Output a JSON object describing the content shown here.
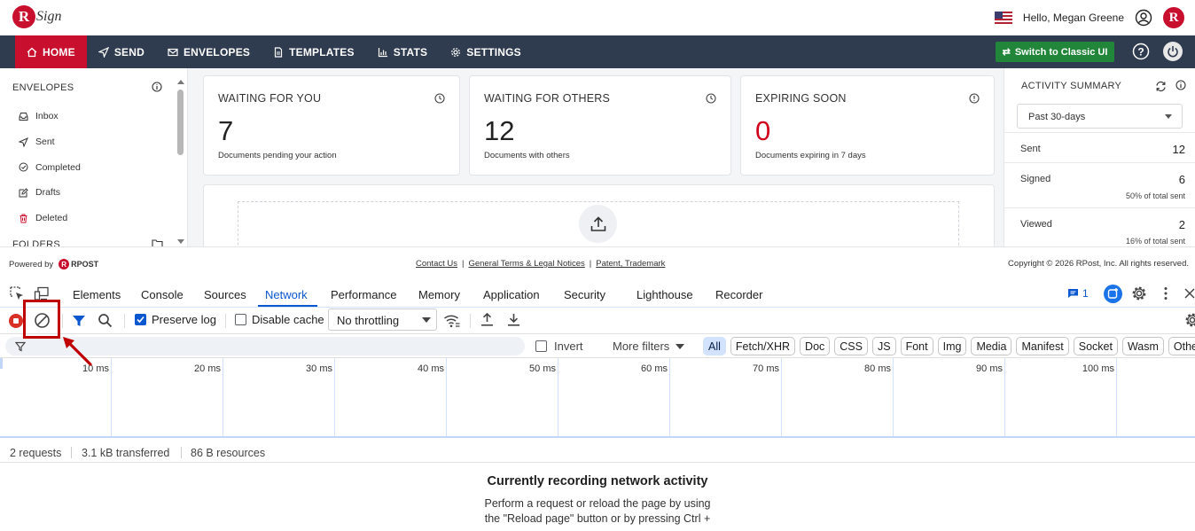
{
  "app": {
    "logo_letter": "R",
    "logo_text": "Sign",
    "greeting": "Hello, Megan Greene",
    "badge_letter": "R"
  },
  "nav": {
    "items": [
      {
        "label": "HOME",
        "icon": "home-icon"
      },
      {
        "label": "SEND",
        "icon": "send-icon"
      },
      {
        "label": "ENVELOPES",
        "icon": "envelope-icon"
      },
      {
        "label": "TEMPLATES",
        "icon": "template-icon"
      },
      {
        "label": "STATS",
        "icon": "stats-icon"
      },
      {
        "label": "SETTINGS",
        "icon": "gear-icon"
      }
    ],
    "classic_button": "Switch to Classic UI"
  },
  "sidebar": {
    "heading": "ENVELOPES",
    "items": [
      {
        "label": "Inbox",
        "icon": "inbox-icon"
      },
      {
        "label": "Sent",
        "icon": "send-icon"
      },
      {
        "label": "Completed",
        "icon": "check-circle-icon"
      },
      {
        "label": "Drafts",
        "icon": "edit-icon"
      },
      {
        "label": "Deleted",
        "icon": "trash-icon"
      }
    ],
    "folders_heading": "FOLDERS"
  },
  "cards": [
    {
      "title": "WAITING FOR YOU",
      "value": "7",
      "subtitle": "Documents pending your action"
    },
    {
      "title": "WAITING FOR OTHERS",
      "value": "12",
      "subtitle": "Documents with others"
    },
    {
      "title": "EXPIRING SOON",
      "value": "0",
      "subtitle": "Documents expiring in 7 days"
    }
  ],
  "activity": {
    "title": "ACTIVITY SUMMARY",
    "period": "Past 30-days",
    "rows": [
      {
        "label": "Sent",
        "value": "12",
        "note": ""
      },
      {
        "label": "Signed",
        "value": "6",
        "note": "50% of total sent"
      },
      {
        "label": "Viewed",
        "value": "2",
        "note": "16% of total sent"
      }
    ]
  },
  "footer": {
    "powered_by": "Powered by",
    "rpost": "RPOST",
    "links": [
      "Contact Us",
      "General Terms & Legal Notices",
      "Patent, Trademark"
    ],
    "separator": "|",
    "copyright": "Copyright © 2026 RPost, Inc. All rights reserved."
  },
  "devtools": {
    "tabs": [
      "Elements",
      "Console",
      "Sources",
      "Network",
      "Performance",
      "Memory",
      "Application",
      "Security",
      "Lighthouse",
      "Recorder"
    ],
    "active_tab": "Network",
    "message_count": "1",
    "preserve_log": "Preserve log",
    "disable_cache": "Disable cache",
    "throttling": "No throttling",
    "invert": "Invert",
    "more_filters": "More filters",
    "filter_chips": [
      "All",
      "Fetch/XHR",
      "Doc",
      "CSS",
      "JS",
      "Font",
      "Img",
      "Media",
      "Manifest",
      "Socket",
      "Wasm",
      "Other"
    ],
    "timeline_ticks": [
      "10 ms",
      "20 ms",
      "30 ms",
      "40 ms",
      "50 ms",
      "60 ms",
      "70 ms",
      "80 ms",
      "90 ms",
      "100 ms"
    ],
    "status": {
      "requests": "2 requests",
      "transferred": "3.1 kB transferred",
      "resources": "86 B resources"
    },
    "empty_title": "Currently recording network activity",
    "empty_text_1": "Perform a request or reload the page by using",
    "empty_text_2": "the \"Reload page\" button or by pressing Ctrl +"
  },
  "colors": {
    "brand_red": "#c8102e",
    "nav_bg": "#2f3b4e",
    "classic_green": "#22863a",
    "devtools_blue": "#0b57d0",
    "annotation_red": "#c00000"
  }
}
